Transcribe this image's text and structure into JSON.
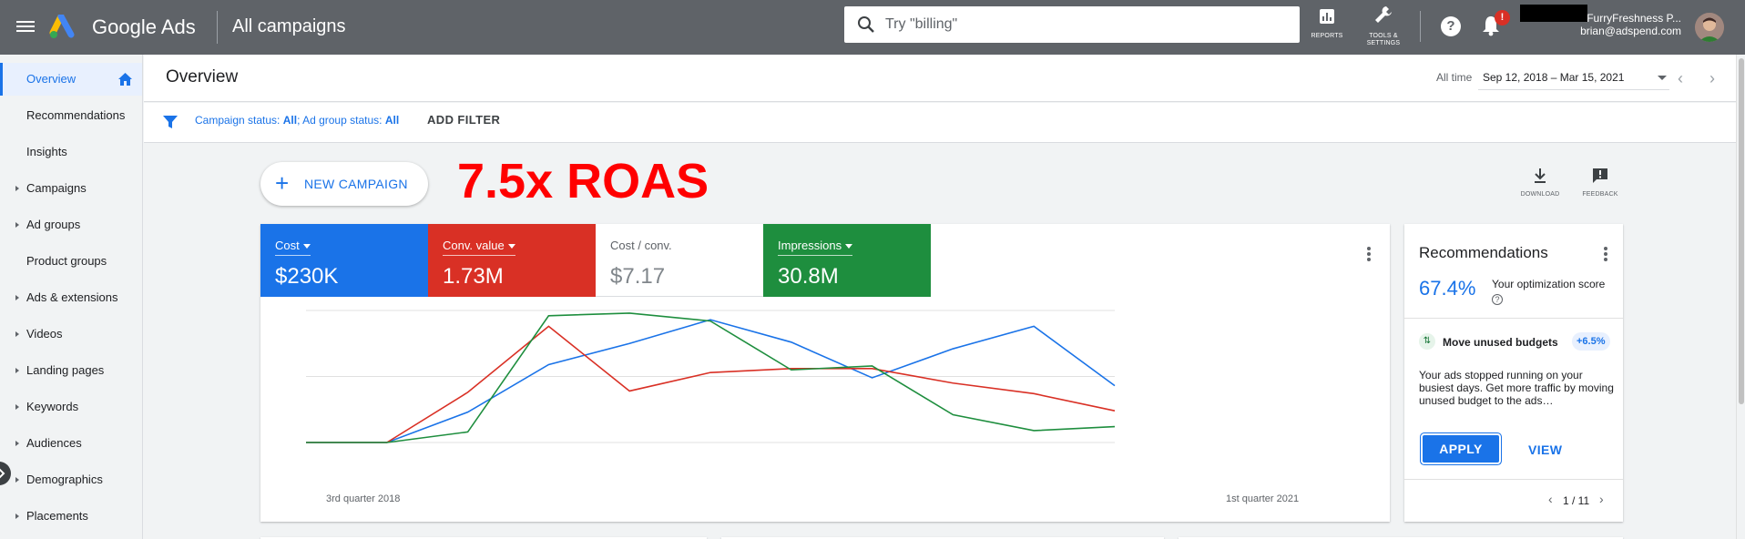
{
  "app": {
    "brand": "Google Ads",
    "page_title": "All campaigns",
    "search_placeholder": "Try \"billing\"",
    "tools": [
      {
        "label": "REPORTS",
        "icon": "bar-chart-icon"
      },
      {
        "label": "TOOLS &\nSETTINGS",
        "icon": "wrench-icon"
      }
    ],
    "notification_badge": "!",
    "account_name": "FurryFreshness P...",
    "account_email": "brian@adspend.com"
  },
  "sidebar": {
    "items": [
      {
        "label": "Overview",
        "active": true,
        "expandable": false
      },
      {
        "label": "Recommendations",
        "active": false,
        "expandable": false
      },
      {
        "label": "Insights",
        "active": false,
        "expandable": false
      },
      {
        "label": "Campaigns",
        "active": false,
        "expandable": true
      },
      {
        "label": "Ad groups",
        "active": false,
        "expandable": true
      },
      {
        "label": "Product groups",
        "active": false,
        "expandable": false
      },
      {
        "label": "Ads & extensions",
        "active": false,
        "expandable": true
      },
      {
        "label": "Videos",
        "active": false,
        "expandable": true
      },
      {
        "label": "Landing pages",
        "active": false,
        "expandable": true
      },
      {
        "label": "Keywords",
        "active": false,
        "expandable": true
      },
      {
        "label": "Audiences",
        "active": false,
        "expandable": true
      },
      {
        "label": "Demographics",
        "active": false,
        "expandable": true
      },
      {
        "label": "Placements",
        "active": false,
        "expandable": true
      }
    ]
  },
  "header": {
    "title": "Overview",
    "date_label": "All time",
    "date_range": "Sep 12, 2018 – Mar 15, 2021"
  },
  "filter": {
    "campaign_label": "Campaign status: ",
    "campaign_value": "All",
    "sep": "; ",
    "adgroup_label": "Ad group status: ",
    "adgroup_value": "All",
    "add_filter": "ADD FILTER"
  },
  "actions": {
    "new_campaign": "NEW CAMPAIGN",
    "roas_annotation": "7.5x ROAS",
    "download": "DOWNLOAD",
    "feedback": "FEEDBACK"
  },
  "metrics": [
    {
      "label": "Cost",
      "value": "$230K",
      "color": "#1a73e8",
      "dropdown": true
    },
    {
      "label": "Conv. value",
      "value": "1.73M",
      "color": "#d93025",
      "dropdown": true
    },
    {
      "label": "Cost / conv.",
      "value": "$7.17",
      "color": "#ffffff",
      "dropdown": false
    },
    {
      "label": "Impressions",
      "value": "30.8M",
      "color": "#1e8e3e",
      "dropdown": true
    }
  ],
  "chart_data": {
    "type": "line",
    "x": [
      "3rd quarter 2018",
      "",
      "",
      "",
      "",
      "",
      "",
      "",
      "",
      "",
      "",
      "",
      "1st quarter 2021"
    ],
    "x_tick_labels": [
      "3rd quarter 2018",
      "1st quarter 2021"
    ],
    "series": [
      {
        "name": "Cost",
        "color": "#1a73e8",
        "values": [
          0,
          0,
          0.23,
          0.59,
          0.75,
          0.93,
          0.76,
          0.49,
          0.71,
          0.88,
          0.43,
          null,
          null
        ]
      },
      {
        "name": "Conv. value",
        "color": "#d93025",
        "values": [
          0,
          0,
          0.38,
          0.88,
          0.39,
          0.53,
          0.56,
          0.56,
          0.45,
          0.37,
          0.24,
          null,
          null
        ]
      },
      {
        "name": "Impressions",
        "color": "#1e8e3e",
        "values": [
          0,
          0,
          0.08,
          0.96,
          0.98,
          0.92,
          0.55,
          0.58,
          0.21,
          0.09,
          0.12,
          null,
          null
        ]
      }
    ],
    "grid": true,
    "legend": "none"
  },
  "recommendations": {
    "title": "Recommendations",
    "score": "67.4%",
    "score_label": "Your optimization score",
    "item_title": "Move unused budgets",
    "item_uplift": "+6.5%",
    "item_desc": "Your ads stopped running on your busiest days. Get more traffic by moving unused budget to the ads…",
    "apply": "APPLY",
    "view": "VIEW",
    "page": "1 / 11"
  }
}
